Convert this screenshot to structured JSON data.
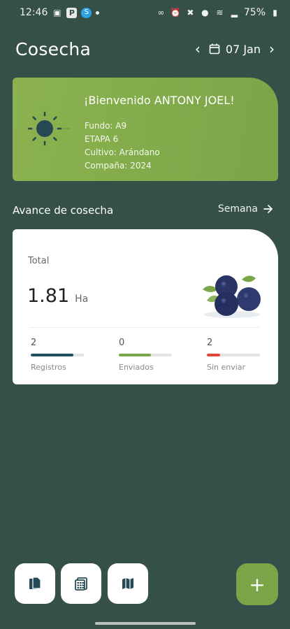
{
  "status_bar": {
    "time": "12:46",
    "battery": "75%",
    "left_icons": [
      "image-icon",
      "parking-icon",
      "shazam-icon",
      "dot-icon"
    ],
    "right_icons": [
      "link-icon",
      "alarm-icon",
      "mute-icon",
      "location-icon",
      "wifi-icon",
      "signal-icon",
      "battery-icon"
    ]
  },
  "header": {
    "title": "Cosecha",
    "date": "07 Jan"
  },
  "welcome": {
    "greeting": "¡Bienvenido ANTONY JOEL!",
    "fundo": "Fundo: A9",
    "etapa": "ETAPA 6",
    "cultivo": "Cultivo: Arándano",
    "campana": "Compaña: 2024",
    "icon": "sun-icon"
  },
  "progress": {
    "section_title": "Avance de cosecha",
    "range_link": "Semana",
    "total_label": "Total",
    "total_value": "1.81",
    "total_unit": "Ha",
    "stats": [
      {
        "value": "2",
        "label": "Registros",
        "color": "#1f4e5e",
        "fill": 0.8
      },
      {
        "value": "0",
        "label": "Enviados",
        "color": "#7aa548",
        "fill": 0.6
      },
      {
        "value": "2",
        "label": "Sin enviar",
        "color": "#e0453a",
        "fill": 0.25
      }
    ]
  },
  "actions": {
    "add_label": "+",
    "buttons": [
      "document-icon",
      "calculator-icon",
      "map-icon"
    ]
  },
  "colors": {
    "background": "#355049",
    "accent": "#7aa548"
  }
}
